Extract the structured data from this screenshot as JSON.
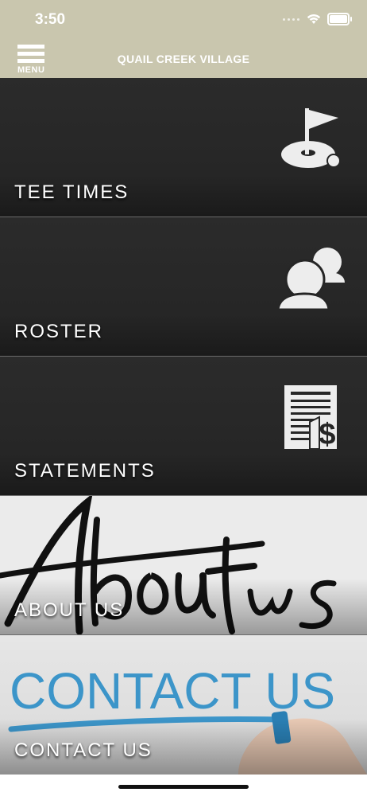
{
  "status_bar": {
    "time": "3:50"
  },
  "header": {
    "menu_label": "MENU",
    "title": "QUAIL CREEK VILLAGE"
  },
  "tiles": [
    {
      "label": "TEE TIMES",
      "icon": "golf-flag-icon"
    },
    {
      "label": "ROSTER",
      "icon": "people-icon"
    },
    {
      "label": "STATEMENTS",
      "icon": "statement-dollar-icon"
    },
    {
      "label": "ABOUT US",
      "image_text": "About us"
    },
    {
      "label": "CONTACT US",
      "image_text": "CONTACT US"
    }
  ],
  "colors": {
    "header_bg": "#c9c6ae",
    "tile_dark": "#2b2b2b",
    "contact_blue": "#3c95c9"
  }
}
